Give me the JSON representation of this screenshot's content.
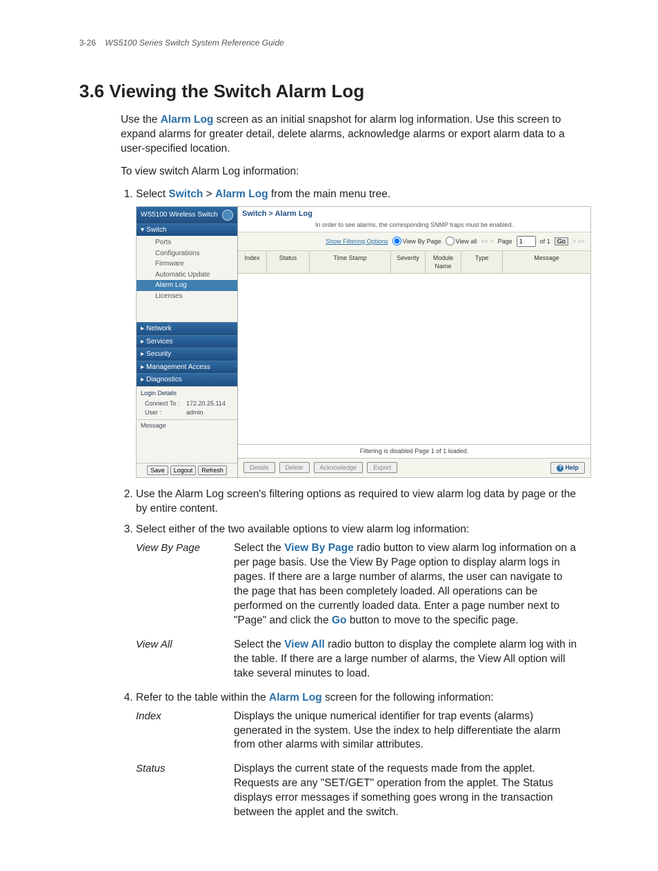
{
  "header": {
    "page_code": "3-26",
    "doc_title": "WS5100 Series Switch System Reference Guide"
  },
  "title": "3.6 Viewing the Switch Alarm Log",
  "intro": {
    "part1": "Use the ",
    "kw1": "Alarm Log",
    "part2": " screen as an initial snapshot for alarm log information. Use this screen to expand alarms for greater detail, delete alarms, acknowledge alarms or export alarm data to a user-specified location."
  },
  "lead": "To view switch Alarm Log information:",
  "steps": {
    "s1a": "Select ",
    "s1_kw1": "Switch",
    "s1_mid": " > ",
    "s1_kw2": "Alarm Log",
    "s1b": " from the main menu tree.",
    "s2": "Use the Alarm Log screen's filtering options as required to view alarm log data by page or the by entire content.",
    "s3": "Select either of the two available options to view alarm log information:",
    "s4a": "Refer to the table within the ",
    "s4_kw": "Alarm Log",
    "s4b": " screen for the following information:"
  },
  "options": {
    "viewByPage": {
      "term": "View By Page",
      "da": "Select the ",
      "kw1": "View By Page",
      "db": " radio button to view alarm log information on a per page basis. Use the View By Page option to display alarm logs in pages. If there are a large number of alarms, the user can navigate to the page that has been completely loaded. All operations can be performed on the currently loaded data. Enter a page number next to \"Page\" and click the ",
      "kw2": "Go",
      "dc": " button to move to the specific page."
    },
    "viewAll": {
      "term": "View All",
      "da": "Select the ",
      "kw1": "View All",
      "db": " radio button to display the complete alarm log with in the table. If there are a large number of alarms, the View All option will take several minutes to load."
    }
  },
  "fields": {
    "index": {
      "term": "Index",
      "desc": "Displays the unique numerical identifier for trap events (alarms) generated in the system. Use the index to help differentiate the alarm from other alarms with similar attributes."
    },
    "status": {
      "term": "Status",
      "desc": "Displays the current state of the requests made from the applet. Requests are any \"SET/GET\" operation from the applet. The Status displays error messages if something goes wrong in the transaction between the applet and the switch."
    }
  },
  "screenshot": {
    "brand": "WS5100 Wireless Switch",
    "nav": {
      "switch": "Switch",
      "network": "Network",
      "services": "Services",
      "security": "Security",
      "mgmt": "Management Access",
      "diag": "Diagnostics"
    },
    "tree": {
      "ports": "Ports",
      "config": "Configurations",
      "firmware": "Firmware",
      "auto": "Automatic Update",
      "alarm": "Alarm Log",
      "lic": "Licenses"
    },
    "login": {
      "hdr": "Login Details",
      "connect_lab": "Connect To :",
      "connect_val": "172.20.25.114",
      "user_lab": "User :",
      "user_val": "admin",
      "msg_hdr": "Message"
    },
    "navbtn": {
      "save": "Save",
      "logout": "Logout",
      "refresh": "Refresh"
    },
    "crumb": "Switch > Alarm Log",
    "note": "In order to see alarms, the corresponding SNMP traps must be enabled.",
    "toolbar": {
      "filter": "Show Filtering Options",
      "bypage": "View By Page",
      "viewall": "View all",
      "nav_prev": "<< <",
      "page_lab": "Page",
      "page_val": "1",
      "of": "of 1",
      "go": "Go",
      "nav_next": "> >>"
    },
    "cols": {
      "index": "Index",
      "status": "Status",
      "time": "Time Stamp",
      "sev": "Severity",
      "mod": "Module Name",
      "type": "Type",
      "msg": "Message"
    },
    "status_bar": "Filtering is disabled      Page 1 of 1 loaded.",
    "actions": {
      "details": "Details",
      "delete": "Delete",
      "ack": "Acknowledge",
      "export": "Export",
      "help": "Help"
    }
  }
}
